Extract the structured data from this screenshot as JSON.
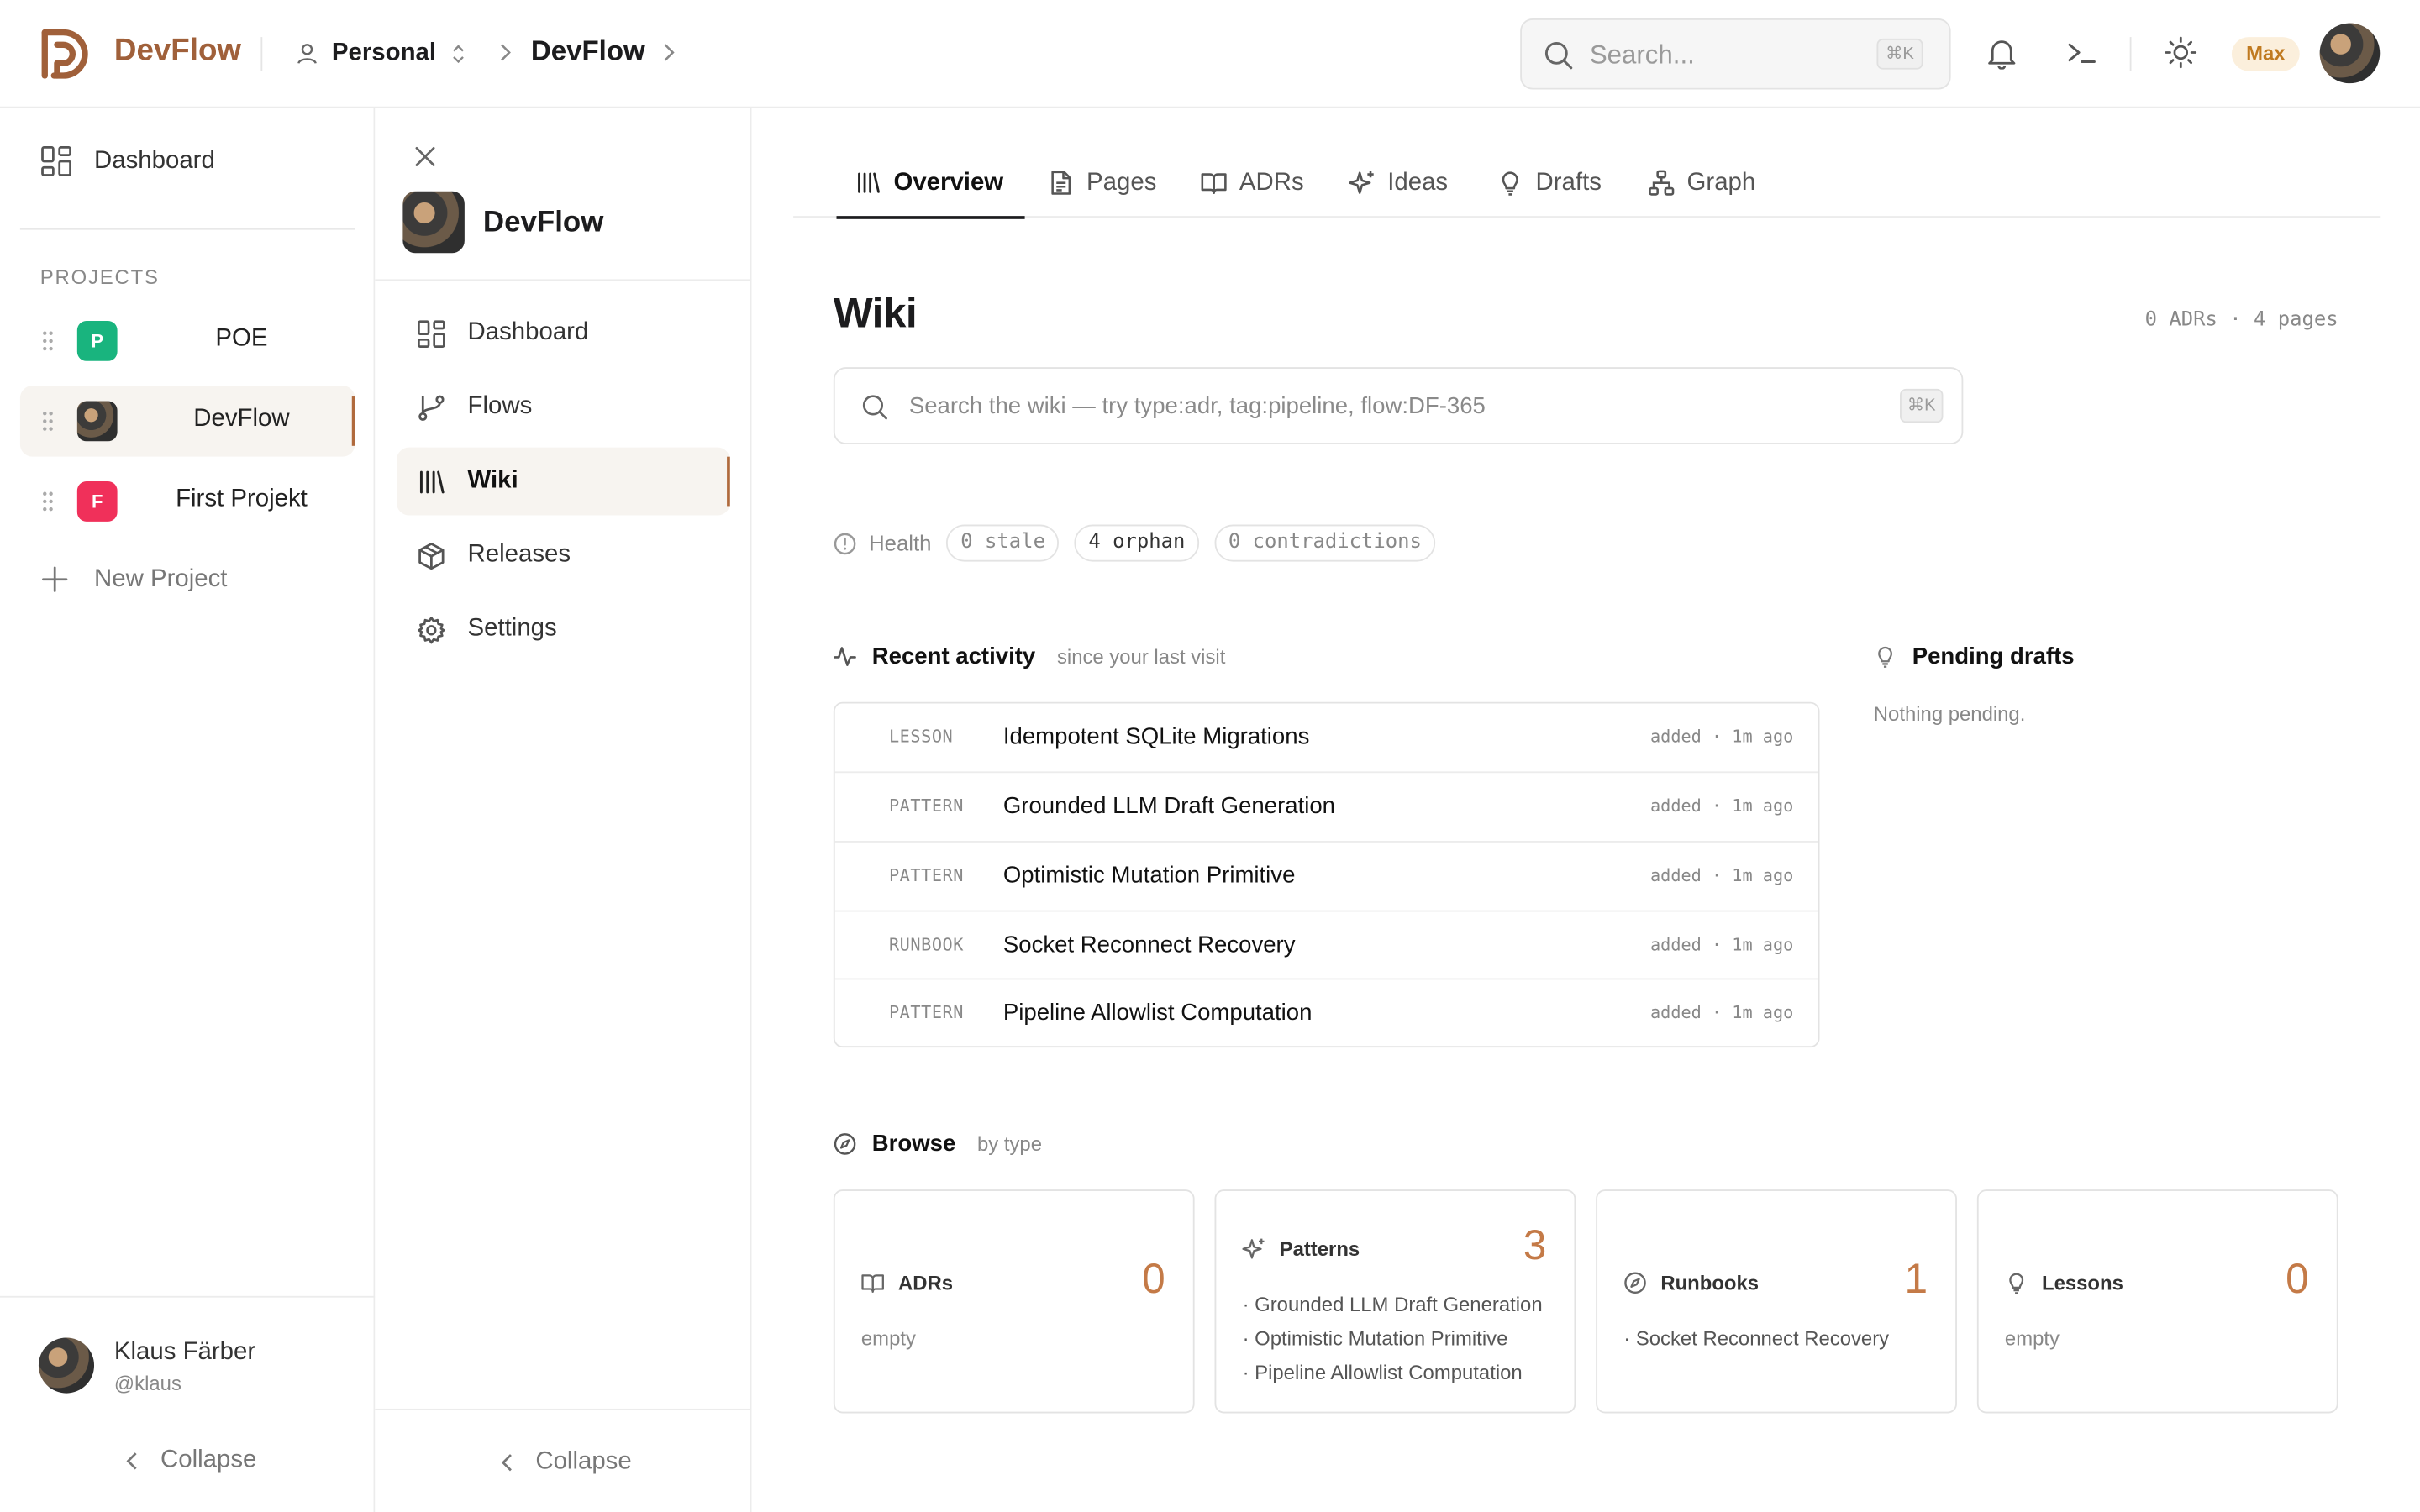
{
  "app": {
    "brand": "DevFlow",
    "accent": "#a0603a",
    "active_bar": "#b06a3d",
    "count_color": "#c47a47"
  },
  "header": {
    "workspace": "Personal",
    "breadcrumb": "DevFlow",
    "search_placeholder": "Search...",
    "search_shortcut": "⌘K",
    "user_badge": "Max",
    "icons": [
      "bell-icon",
      "terminal-icon",
      "sun-icon"
    ]
  },
  "leftbar": {
    "dashboard_label": "Dashboard",
    "projects_heading": "PROJECTS",
    "projects": [
      {
        "initial": "P",
        "name": "POE",
        "color": "#19b47e"
      },
      {
        "initial": "",
        "name": "DevFlow",
        "color": ""
      },
      {
        "initial": "F",
        "name": "First Projekt",
        "color": "#f0305a"
      }
    ],
    "new_project": "New Project",
    "user": {
      "name": "Klaus Färber",
      "handle": "@klaus"
    },
    "collapse_label": "Collapse"
  },
  "sidebar": {
    "project_title": "DevFlow",
    "items": [
      {
        "label": "Dashboard",
        "icon": "grid-icon"
      },
      {
        "label": "Flows",
        "icon": "git-branch-icon"
      },
      {
        "label": "Wiki",
        "icon": "library-icon"
      },
      {
        "label": "Releases",
        "icon": "package-icon"
      },
      {
        "label": "Settings",
        "icon": "gear-icon"
      }
    ],
    "active": "Wiki",
    "collapse_label": "Collapse"
  },
  "tabs": [
    {
      "label": "Overview",
      "icon": "library-icon"
    },
    {
      "label": "Pages",
      "icon": "file-text-icon"
    },
    {
      "label": "ADRs",
      "icon": "book-open-icon"
    },
    {
      "label": "Ideas",
      "icon": "sparkles-icon"
    },
    {
      "label": "Drafts",
      "icon": "lightbulb-icon"
    },
    {
      "label": "Graph",
      "icon": "network-icon"
    }
  ],
  "wiki": {
    "title": "Wiki",
    "stats": "0 ADRs · 4 pages",
    "search_placeholder": "Search the wiki — try type:adr, tag:pipeline, flow:DF-365",
    "search_shortcut": "⌘K",
    "health": {
      "label": "Health",
      "stale": "0 stale",
      "orphan": "4 orphan",
      "contradictions": "0 contradictions"
    }
  },
  "activity": {
    "title": "Recent activity",
    "subtitle": "since your last visit",
    "rows": [
      {
        "type": "LESSON",
        "title": "Idempotent SQLite Migrations",
        "meta": "added · 1m ago"
      },
      {
        "type": "PATTERN",
        "title": "Grounded LLM Draft Generation",
        "meta": "added · 1m ago"
      },
      {
        "type": "PATTERN",
        "title": "Optimistic Mutation Primitive",
        "meta": "added · 1m ago"
      },
      {
        "type": "RUNBOOK",
        "title": "Socket Reconnect Recovery",
        "meta": "added · 1m ago"
      },
      {
        "type": "PATTERN",
        "title": "Pipeline Allowlist Computation",
        "meta": "added · 1m ago"
      }
    ]
  },
  "drafts": {
    "title": "Pending drafts",
    "empty": "Nothing pending."
  },
  "browse": {
    "title": "Browse",
    "subtitle": "by type",
    "cards": [
      {
        "title": "ADRs",
        "icon": "book-open-icon",
        "count": "0",
        "empty": "empty",
        "items": []
      },
      {
        "title": "Patterns",
        "icon": "sparkles-icon",
        "count": "3",
        "empty": "",
        "items": [
          "· Grounded LLM Draft Generation",
          "· Optimistic Mutation Primitive",
          "· Pipeline Allowlist Computation"
        ]
      },
      {
        "title": "Runbooks",
        "icon": "compass-icon",
        "count": "1",
        "empty": "",
        "items": [
          "· Socket Reconnect Recovery"
        ]
      },
      {
        "title": "Lessons",
        "icon": "lightbulb-icon",
        "count": "0",
        "empty": "empty",
        "items": []
      }
    ]
  }
}
